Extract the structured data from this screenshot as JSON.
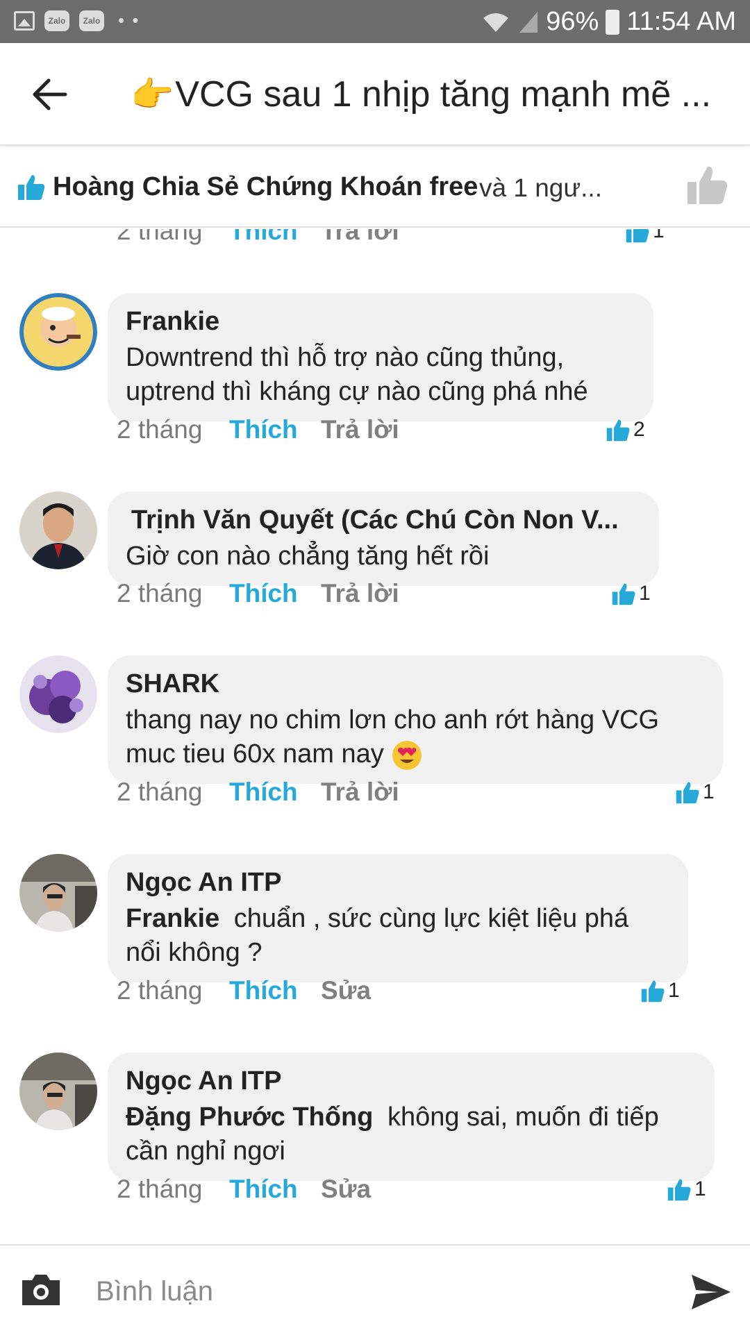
{
  "status_bar": {
    "battery": "96%",
    "time": "11:54 AM",
    "zalo_label_1": "Zalo",
    "zalo_label_2": "Zalo",
    "dots": "• •"
  },
  "header": {
    "title": "VCG sau 1 nhịp tăng mạnh mẽ ..."
  },
  "likes": {
    "names": "Hoàng Chia Sẻ Chứng Khoán free",
    "rest": "và 1 ngư..."
  },
  "labels": {
    "like": "Thích",
    "reply": "Trả lời",
    "edit": "Sửa"
  },
  "top_meta": {
    "time": "2 tháng",
    "count": "1"
  },
  "comments": [
    {
      "author": "Frankie",
      "text": "Downtrend thì hỗ trợ nào cũng thủng, uptrend thì kháng cự nào cũng phá nhé",
      "time": "2 tháng",
      "likes": "2"
    },
    {
      "author": "Trịnh Văn Quyết (Các Chú Còn Non V...",
      "text": "Giờ con nào chẳng tăng hết rồi",
      "time": "2 tháng",
      "likes": "1"
    },
    {
      "author": "SHARK",
      "text": "thang nay no chim lơn cho anh rớt hàng VCG muc tieu 60x nam nay",
      "time": "2 tháng",
      "likes": "1"
    },
    {
      "author": "Ngọc An ITP",
      "mention": "Frankie",
      "text": "chuẩn , sức cùng lực kiệt liệu phá nổi không ?",
      "time": "2 tháng",
      "likes": "1"
    },
    {
      "author": "Ngọc An ITP",
      "mention": "Đặng Phước Thống",
      "text": "không sai, muốn đi tiếp cần nghỉ ngơi",
      "time": "2 tháng",
      "likes": "1"
    }
  ],
  "composer": {
    "placeholder": "Bình luận"
  },
  "colors": {
    "accent": "#26a9d8",
    "status_bar": "#6d6d6d",
    "bubble": "#f1f1f1"
  }
}
